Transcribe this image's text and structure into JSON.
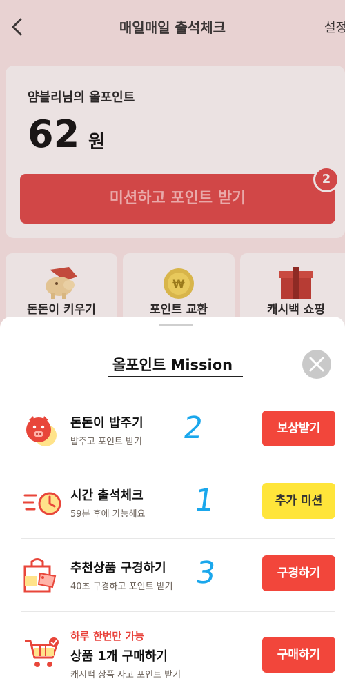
{
  "header": {
    "title": "매일매일 출석체크",
    "settings_label": "설정"
  },
  "points_card": {
    "label": "얌블리님의 올포인트",
    "amount": "62",
    "unit": "원",
    "mission_button_label": "미션하고 포인트 받기",
    "mission_badge": "2"
  },
  "tiles": [
    {
      "label": "돈돈이 키우기",
      "icon": "piggy-icon"
    },
    {
      "label": "포인트 교환",
      "icon": "coin-icon"
    },
    {
      "label": "캐시백 쇼핑",
      "icon": "giftbox-icon"
    }
  ],
  "sheet": {
    "title": "올포인트 Mission",
    "missions": [
      {
        "title": "돈돈이 밥주기",
        "subtitle": "밥주고 포인트 받기",
        "button": "보상받기",
        "note": "2",
        "icon": "pig-face-icon"
      },
      {
        "title": "시간 출석체크",
        "subtitle": "59분 후에 가능해요",
        "button": "추가 미션",
        "note": "1",
        "icon": "clock-icon"
      },
      {
        "title": "추천상품 구경하기",
        "subtitle": "40초 구경하고 포인트 받기",
        "button": "구경하기",
        "note": "3",
        "icon": "shopping-bag-icon"
      },
      {
        "super": "하루 한번만 가능",
        "title": "상품 1개 구매하기",
        "subtitle": "캐시백 상품 사고 포인트 받기",
        "button": "구매하기",
        "icon": "cart-icon"
      }
    ]
  },
  "colors": {
    "primary_red": "#f2463b",
    "accent_yellow": "#ffe53a",
    "dimmed_bg": "#e8d2d2"
  }
}
